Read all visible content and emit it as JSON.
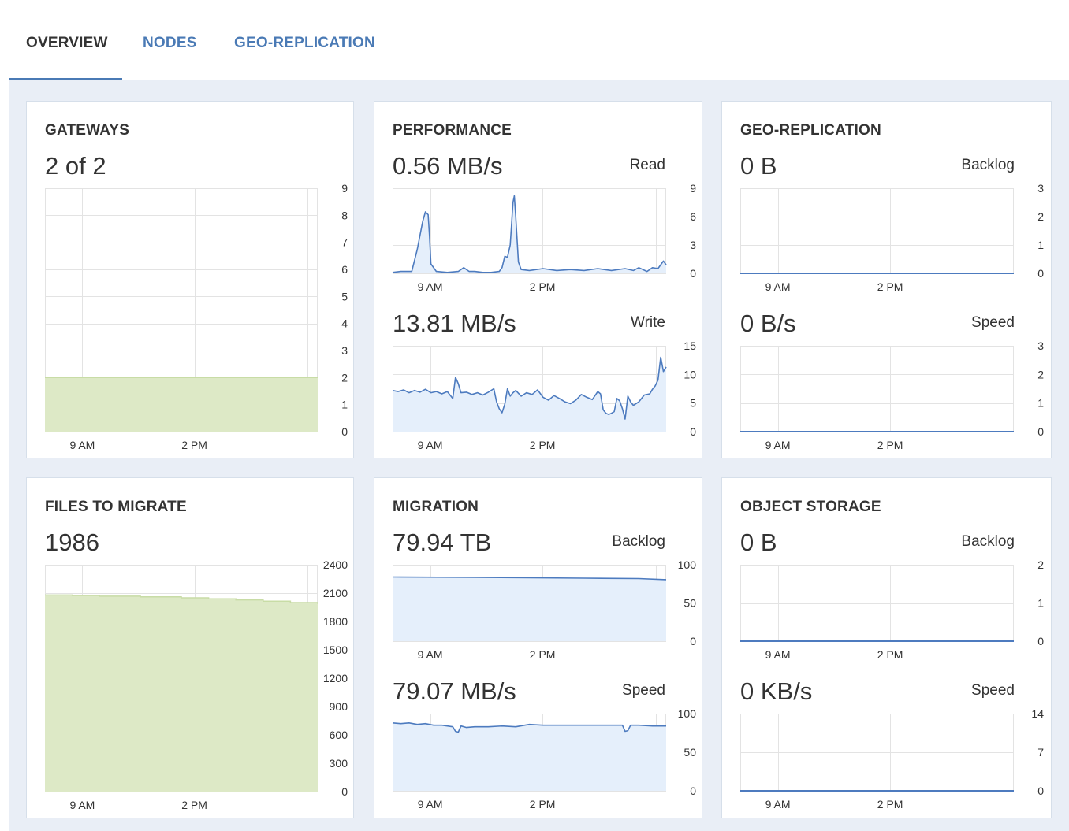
{
  "tabs": [
    {
      "label": "OVERVIEW",
      "active": true
    },
    {
      "label": "NODES",
      "active": false
    },
    {
      "label": "GEO-REPLICATION",
      "active": false
    }
  ],
  "colors": {
    "accent": "#4a7ab5",
    "line": "#4d7bbf",
    "area_blue": "#e5effb",
    "area_green": "#dde9c6",
    "green_line": "#c8dca6",
    "grid": "#e3e3e3",
    "background": "#e9eef6"
  },
  "cards": {
    "gateways": {
      "title": "GATEWAYS",
      "value": "2 of 2"
    },
    "performance": {
      "title": "PERFORMANCE",
      "read_value": "0.56 MB/s",
      "read_label": "Read",
      "write_value": "13.81 MB/s",
      "write_label": "Write"
    },
    "geo_replication": {
      "title": "GEO-REPLICATION",
      "backlog_value": "0 B",
      "backlog_label": "Backlog",
      "speed_value": "0 B/s",
      "speed_label": "Speed"
    },
    "files_to_migrate": {
      "title": "FILES TO MIGRATE",
      "value": "1986"
    },
    "migration": {
      "title": "MIGRATION",
      "backlog_value": "79.94 TB",
      "backlog_label": "Backlog",
      "speed_value": "79.07 MB/s",
      "speed_label": "Speed"
    },
    "object_storage": {
      "title": "OBJECT STORAGE",
      "backlog_value": "0 B",
      "backlog_label": "Backlog",
      "speed_value": "0 KB/s",
      "speed_label": "Speed"
    }
  },
  "chart_data": [
    {
      "id": "gateways",
      "type": "area",
      "x_ticks": [
        "9 AM",
        "2 PM"
      ],
      "ylim": [
        0,
        9
      ],
      "y_ticks": [
        0,
        1,
        2,
        3,
        4,
        5,
        6,
        7,
        8,
        9
      ],
      "style": "green",
      "x": [
        0,
        1
      ],
      "values": [
        2,
        2
      ]
    },
    {
      "id": "perf_read",
      "type": "area",
      "x_ticks": [
        "9 AM",
        "2 PM"
      ],
      "ylim": [
        0,
        9
      ],
      "y_ticks": [
        0,
        3,
        6,
        9
      ],
      "style": "blue",
      "x": [
        0,
        0.03,
        0.07,
        0.09,
        0.11,
        0.12,
        0.13,
        0.135,
        0.14,
        0.16,
        0.2,
        0.24,
        0.26,
        0.28,
        0.3,
        0.33,
        0.36,
        0.39,
        0.4,
        0.41,
        0.42,
        0.43,
        0.44,
        0.445,
        0.45,
        0.46,
        0.47,
        0.5,
        0.55,
        0.6,
        0.65,
        0.7,
        0.75,
        0.8,
        0.85,
        0.88,
        0.9,
        0.93,
        0.95,
        0.97,
        0.99,
        1
      ],
      "values": [
        0.1,
        0.2,
        0.2,
        2.5,
        5.5,
        6.5,
        6.2,
        4,
        1,
        0.2,
        0.1,
        0.2,
        0.6,
        0.2,
        0.2,
        0.1,
        0.1,
        0.2,
        0.6,
        1.8,
        1.7,
        3,
        7.5,
        8.2,
        6,
        1.2,
        0.4,
        0.3,
        0.5,
        0.3,
        0.4,
        0.3,
        0.5,
        0.3,
        0.5,
        0.3,
        0.6,
        0.2,
        0.6,
        0.5,
        1.3,
        0.9
      ]
    },
    {
      "id": "perf_write",
      "type": "area",
      "x_ticks": [
        "9 AM",
        "2 PM"
      ],
      "ylim": [
        0,
        15
      ],
      "y_ticks": [
        0,
        5,
        10,
        15
      ],
      "style": "blue",
      "x": [
        0,
        0.02,
        0.04,
        0.06,
        0.08,
        0.1,
        0.12,
        0.14,
        0.16,
        0.18,
        0.2,
        0.22,
        0.23,
        0.24,
        0.25,
        0.27,
        0.29,
        0.31,
        0.33,
        0.35,
        0.37,
        0.38,
        0.39,
        0.4,
        0.41,
        0.42,
        0.43,
        0.44,
        0.45,
        0.47,
        0.49,
        0.51,
        0.53,
        0.55,
        0.57,
        0.59,
        0.61,
        0.63,
        0.65,
        0.67,
        0.69,
        0.71,
        0.73,
        0.75,
        0.76,
        0.77,
        0.78,
        0.79,
        0.8,
        0.81,
        0.82,
        0.83,
        0.84,
        0.85,
        0.86,
        0.87,
        0.88,
        0.9,
        0.92,
        0.94,
        0.95,
        0.96,
        0.97,
        0.98,
        0.99,
        1
      ],
      "values": [
        7.2,
        7.0,
        7.3,
        6.8,
        7.2,
        6.9,
        7.4,
        6.8,
        7.0,
        6.6,
        7.0,
        5.8,
        9.5,
        8.4,
        6.8,
        6.9,
        6.5,
        6.8,
        6.4,
        6.9,
        7.5,
        5.2,
        4.0,
        3.3,
        4.8,
        7.5,
        6.2,
        6.8,
        7.2,
        6.2,
        6.8,
        6.5,
        7.3,
        6.0,
        5.5,
        6.3,
        5.8,
        5.2,
        4.9,
        5.5,
        6.5,
        6.0,
        5.6,
        7.0,
        6.6,
        3.8,
        3.2,
        3.0,
        3.2,
        3.5,
        5.8,
        5.4,
        4.0,
        2.2,
        6.2,
        5.2,
        4.6,
        5.2,
        6.4,
        6.6,
        7.4,
        8.0,
        9.0,
        13.0,
        10.5,
        11.3
      ]
    },
    {
      "id": "geo_backlog",
      "type": "line",
      "x_ticks": [
        "9 AM",
        "2 PM"
      ],
      "ylim": [
        0,
        3
      ],
      "y_ticks": [
        0,
        1,
        2,
        3
      ],
      "style": "flat",
      "x": [
        0,
        1
      ],
      "values": [
        0,
        0
      ]
    },
    {
      "id": "geo_speed",
      "type": "line",
      "x_ticks": [
        "9 AM",
        "2 PM"
      ],
      "ylim": [
        0,
        3
      ],
      "y_ticks": [
        0,
        1,
        2,
        3
      ],
      "style": "flat",
      "x": [
        0,
        1
      ],
      "values": [
        0,
        0
      ]
    },
    {
      "id": "files_to_migrate",
      "type": "area",
      "x_ticks": [
        "9 AM",
        "2 PM"
      ],
      "ylim": [
        0,
        2400
      ],
      "y_ticks": [
        0,
        300,
        600,
        900,
        1200,
        1500,
        1800,
        2100,
        2400
      ],
      "style": "green-steps",
      "x": [
        0,
        0.1,
        0.2,
        0.35,
        0.5,
        0.6,
        0.7,
        0.8,
        0.9,
        1
      ],
      "values": [
        2080,
        2075,
        2068,
        2060,
        2050,
        2040,
        2028,
        2015,
        2000,
        1986
      ]
    },
    {
      "id": "migration_backlog",
      "type": "area",
      "x_ticks": [
        "9 AM",
        "2 PM"
      ],
      "ylim": [
        0,
        100
      ],
      "y_ticks": [
        0,
        50,
        100
      ],
      "style": "blue",
      "x": [
        0,
        0.3,
        0.5,
        0.7,
        0.9,
        1
      ],
      "values": [
        84,
        83.5,
        83,
        82.5,
        82,
        80.5
      ]
    },
    {
      "id": "migration_speed",
      "type": "area",
      "x_ticks": [
        "9 AM",
        "2 PM"
      ],
      "ylim": [
        0,
        100
      ],
      "y_ticks": [
        0,
        50,
        100
      ],
      "style": "blue",
      "x": [
        0,
        0.03,
        0.06,
        0.09,
        0.12,
        0.15,
        0.18,
        0.2,
        0.22,
        0.23,
        0.24,
        0.25,
        0.27,
        0.3,
        0.35,
        0.4,
        0.45,
        0.5,
        0.55,
        0.6,
        0.65,
        0.7,
        0.75,
        0.8,
        0.84,
        0.85,
        0.86,
        0.87,
        0.9,
        0.95,
        1
      ],
      "values": [
        88,
        87,
        88,
        86,
        87,
        85,
        85,
        84,
        83,
        77,
        76,
        84,
        82,
        83,
        83,
        84,
        83,
        86,
        85,
        85,
        85,
        85,
        85,
        85,
        85,
        77,
        78,
        85,
        85,
        84,
        84
      ]
    },
    {
      "id": "os_backlog",
      "type": "line",
      "x_ticks": [
        "9 AM",
        "2 PM"
      ],
      "ylim": [
        0,
        2
      ],
      "y_ticks": [
        0,
        1,
        2
      ],
      "style": "flat",
      "x": [
        0,
        1
      ],
      "values": [
        0,
        0
      ]
    },
    {
      "id": "os_speed",
      "type": "line",
      "x_ticks": [
        "9 AM",
        "2 PM"
      ],
      "ylim": [
        0,
        14
      ],
      "y_ticks": [
        0,
        7,
        14
      ],
      "style": "flat",
      "x": [
        0,
        1
      ],
      "values": [
        0,
        0
      ]
    }
  ]
}
